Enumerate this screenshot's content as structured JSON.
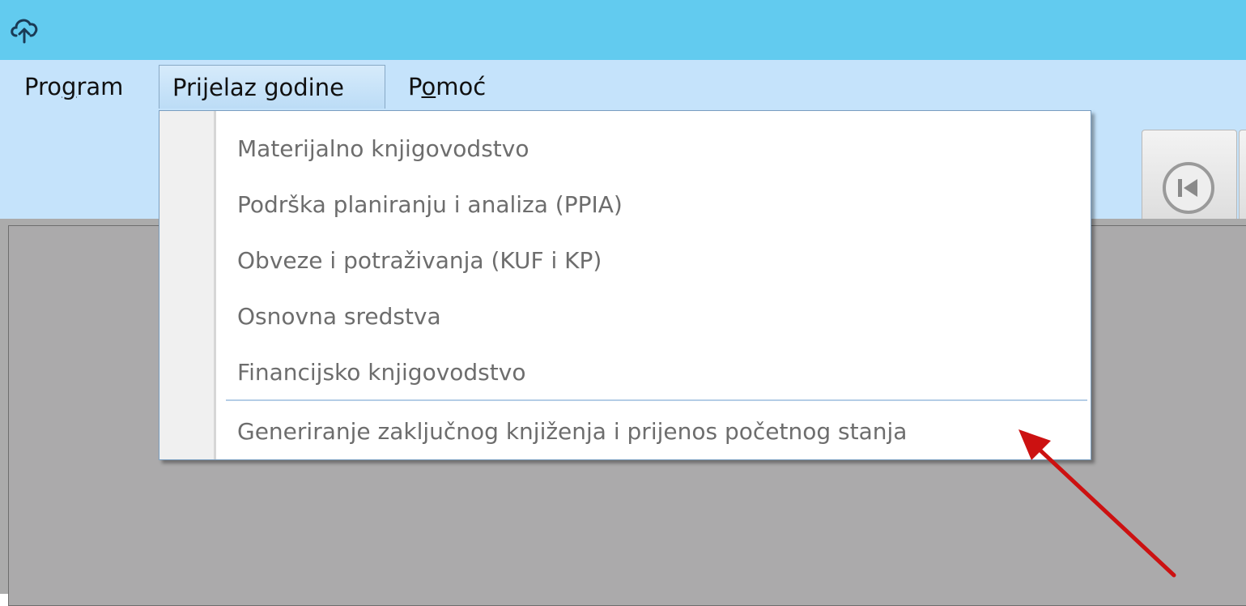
{
  "app": {
    "icon": "cloud-upload-icon"
  },
  "menubar": {
    "items": [
      {
        "pre": "Pro",
        "ul": "g",
        "post": "ram"
      },
      {
        "pre": "",
        "ul": "",
        "post": "Prijelaz godine"
      },
      {
        "pre": "P",
        "ul": "o",
        "post": "moć"
      }
    ]
  },
  "dropdown": {
    "items": [
      "Materijalno knjigovodstvo",
      "Podrška planiranju i analiza (PPIA)",
      "Obveze i potraživanja (KUF i KP)",
      "Osnovna sredstva",
      "Financijsko knjigovodstvo",
      "Generiranje zaključnog knjiženja i prijenos početnog stanja"
    ]
  },
  "toolbar": {
    "first_record_icon": "skip-to-start-icon"
  },
  "annotation": {
    "arrow_color": "#cc1111"
  },
  "colors": {
    "titlebar": "#62cbef",
    "menubar": "#c5e3fb",
    "workspace": "#ababab"
  }
}
